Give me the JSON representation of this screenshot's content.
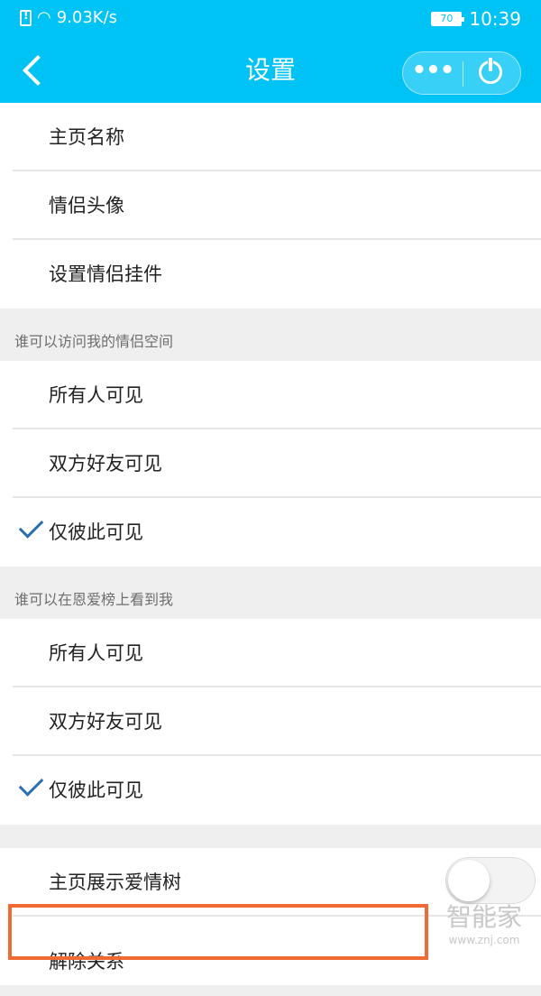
{
  "status_bar": {
    "network_speed": "9.03K/s",
    "battery": "70",
    "time": "10:39"
  },
  "header": {
    "title": "设置",
    "more_icon": "more-dots-icon",
    "power_icon": "power-icon",
    "back_icon": "back-chevron-icon"
  },
  "colors": {
    "header_bg": "#00c3f5",
    "check": "#2a6fb0",
    "highlight": "#f06a36"
  },
  "settings": {
    "items": [
      {
        "label": "主页名称"
      },
      {
        "label": "情侣头像"
      },
      {
        "label": "设置情侣挂件"
      }
    ],
    "visit_section": {
      "title": "谁可以访问我的情侣空间",
      "options": [
        {
          "label": "所有人可见",
          "selected": false
        },
        {
          "label": "双方好友可见",
          "selected": false
        },
        {
          "label": "仅彼此可见",
          "selected": true
        }
      ]
    },
    "ranking_section": {
      "title": "谁可以在恩爱榜上看到我",
      "options": [
        {
          "label": "所有人可见",
          "selected": false
        },
        {
          "label": "双方好友可见",
          "selected": false
        },
        {
          "label": "仅彼此可见",
          "selected": true
        }
      ]
    },
    "love_tree": {
      "label": "主页展示爱情树",
      "enabled": false
    },
    "dissolve": {
      "label": "解除关系"
    }
  },
  "watermark": {
    "brand": "智能家",
    "url": "www.znj.com"
  }
}
